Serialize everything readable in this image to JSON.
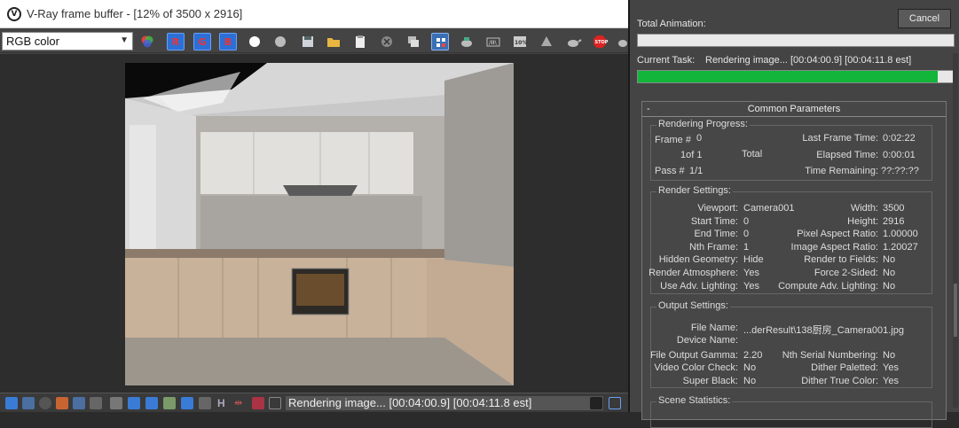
{
  "vfb": {
    "title": "V-Ray frame buffer - [12% of 3500 x 2916]",
    "channel": "RGB color",
    "toolbar": {
      "r_label": "R",
      "g_label": "G",
      "b_label": "B"
    },
    "status_text": "Rendering image... [00:04:00.9] [00:04:11.8 est]"
  },
  "dialog": {
    "total_animation_label": "Total Animation:",
    "cancel_label": "Cancel",
    "total_progress": 0.0,
    "current_task_label": "Current Task:",
    "current_task_value": "Rendering image... [00:04:00.9] [00:04:11.8 est]",
    "task_progress": 0.95,
    "panel_title": "Common Parameters",
    "rendering_progress": {
      "title": "Rendering Progress:",
      "frame_label": "Frame #",
      "frame_value": "0",
      "of_label": "1of 1",
      "total_label": "Total",
      "pass_label": "Pass #",
      "pass_value": "1/1",
      "last_frame_time_label": "Last Frame Time:",
      "last_frame_time_value": "0:02:22",
      "elapsed_time_label": "Elapsed Time:",
      "elapsed_time_value": "0:00:01",
      "time_remaining_label": "Time Remaining:",
      "time_remaining_value": "??:??:??"
    },
    "render_settings": {
      "title": "Render Settings:",
      "left": [
        {
          "label": "Viewport:",
          "value": "Camera001"
        },
        {
          "label": "Start Time:",
          "value": "0"
        },
        {
          "label": "End Time:",
          "value": "0"
        },
        {
          "label": "Nth Frame:",
          "value": "1"
        },
        {
          "label": "Hidden Geometry:",
          "value": "Hide"
        },
        {
          "label": "Render Atmosphere:",
          "value": "Yes"
        },
        {
          "label": "Use Adv. Lighting:",
          "value": "Yes"
        }
      ],
      "right": [
        {
          "label": "Width:",
          "value": "3500"
        },
        {
          "label": "Height:",
          "value": "2916"
        },
        {
          "label": "Pixel Aspect Ratio:",
          "value": "1.00000"
        },
        {
          "label": "Image Aspect Ratio:",
          "value": "1.20027"
        },
        {
          "label": "Render to Fields:",
          "value": "No"
        },
        {
          "label": "Force 2-Sided:",
          "value": "No"
        },
        {
          "label": "Compute Adv. Lighting:",
          "value": "No"
        }
      ]
    },
    "output_settings": {
      "title": "Output Settings:",
      "file_name_label": "File Name:",
      "file_name_value": "...derResult\\138厨房_Camera001.jpg",
      "device_name_label": "Device Name:",
      "file_output_gamma_label": "File Output Gamma:",
      "file_output_gamma_value": "2.20",
      "nth_serial_label": "Nth Serial Numbering:",
      "nth_serial_value": "No",
      "video_color_label": "Video Color Check:",
      "video_color_value": "No",
      "dither_palette_label": "Dither Paletted:",
      "dither_palette_value": "Yes",
      "super_black_label": "Super Black:",
      "super_black_value": "No",
      "dither_true_label": "Dither True Color:",
      "dither_true_value": "Yes"
    },
    "scene_statistics": {
      "title": "Scene Statistics:"
    }
  }
}
